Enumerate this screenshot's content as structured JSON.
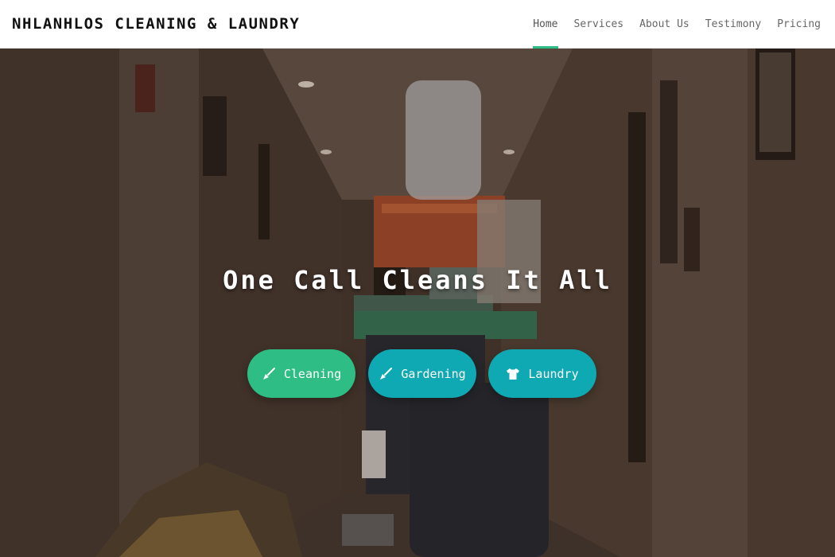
{
  "brand": {
    "title": "NHLANHLOS CLEANING & LAUNDRY"
  },
  "nav": {
    "items": [
      {
        "label": "Home",
        "active": true
      },
      {
        "label": "Services",
        "active": false
      },
      {
        "label": "About Us",
        "active": false
      },
      {
        "label": "Testimony",
        "active": false
      },
      {
        "label": "Pricing",
        "active": false
      }
    ],
    "accent_color": "#2ebd84"
  },
  "hero": {
    "headline": "One Call Cleans It All",
    "background_image": "hotel-corridor-cleaning-cart-photo",
    "buttons": [
      {
        "label": "Cleaning",
        "icon": "broom-icon",
        "color": "#2ebd84"
      },
      {
        "label": "Gardening",
        "icon": "broom-icon",
        "color": "#0fa9b3"
      },
      {
        "label": "Laundry",
        "icon": "tshirt-icon",
        "color": "#0fa9b3"
      }
    ]
  }
}
